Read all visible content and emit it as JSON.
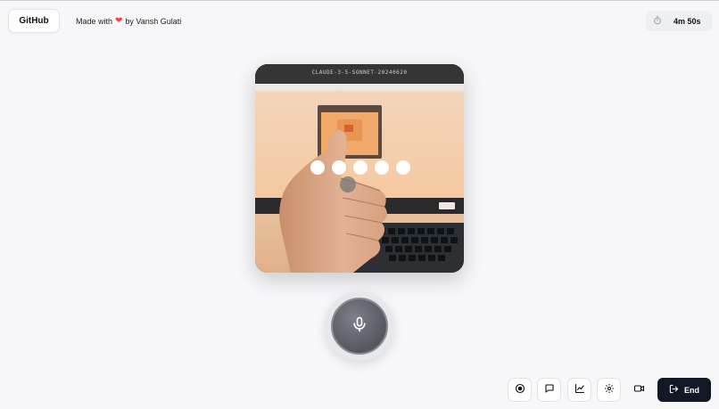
{
  "header": {
    "github_label": "GitHub",
    "made_with_prefix": "Made with",
    "heart": "❤",
    "made_with_suffix": "by Vansh Gulati",
    "timer": "4m 50s"
  },
  "video": {
    "label": "CLAUDE-3-5-SONNET-20240620",
    "dot_count": 5
  },
  "toolbar": {
    "end_label": "End",
    "icons": [
      "record-icon",
      "chat-icon",
      "chart-icon",
      "gear-icon",
      "video-camera-icon",
      "logout-icon"
    ]
  },
  "colors": {
    "background": "#f7f7f9",
    "end_button": "#121826",
    "heart": "#e5484d",
    "mic_button": "#5f6269"
  }
}
